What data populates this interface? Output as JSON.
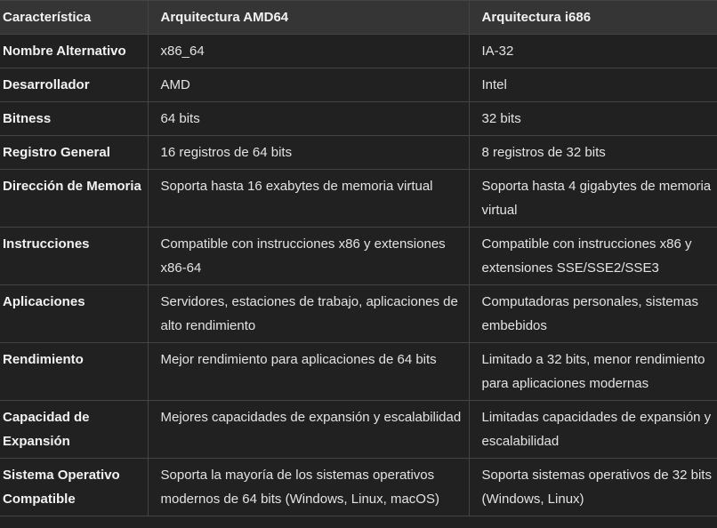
{
  "table": {
    "headers": [
      "Característica",
      "Arquitectura AMD64",
      "Arquitectura i686"
    ],
    "rows": [
      [
        "Nombre Alternativo",
        "x86_64",
        "IA-32"
      ],
      [
        "Desarrollador",
        "AMD",
        "Intel"
      ],
      [
        "Bitness",
        "64 bits",
        "32 bits"
      ],
      [
        "Registro General",
        "16 registros de 64 bits",
        "8 registros de 32 bits"
      ],
      [
        "Dirección de Memoria",
        "Soporta hasta 16 exabytes de memoria virtual",
        "Soporta hasta 4 gigabytes de memoria virtual"
      ],
      [
        "Instrucciones",
        "Compatible con instrucciones x86 y extensiones x86-64",
        "Compatible con instrucciones x86 y extensiones SSE/SSE2/SSE3"
      ],
      [
        "Aplicaciones",
        "Servidores, estaciones de trabajo, aplicaciones de alto rendimiento",
        "Computadoras personales, sistemas embebidos"
      ],
      [
        "Rendimiento",
        "Mejor rendimiento para aplicaciones de 64 bits",
        "Limitado a 32 bits, menor rendimiento para aplicaciones modernas"
      ],
      [
        "Capacidad de Expansión",
        "Mejores capacidades de expansión y escalabilidad",
        "Limitadas capacidades de expansión y escalabilidad"
      ],
      [
        "Sistema Operativo Compatible",
        "Soporta la mayoría de los sistemas operativos modernos de 64 bits (Windows, Linux, macOS)",
        "Soporta sistemas operativos de 32 bits (Windows, Linux)"
      ]
    ]
  }
}
